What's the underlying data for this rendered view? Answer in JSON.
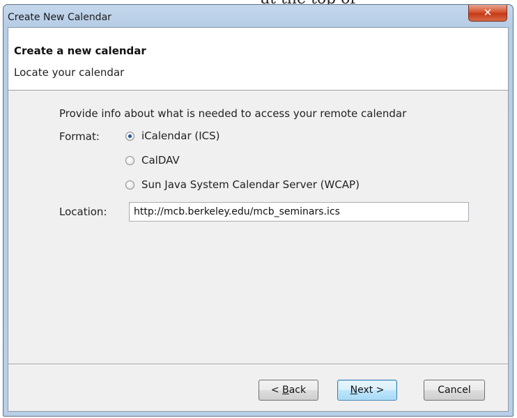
{
  "window": {
    "title": "Create New Calendar",
    "close_glyph": "✕"
  },
  "header": {
    "title": "Create a new calendar",
    "subtitle": "Locate your calendar"
  },
  "body": {
    "intro": "Provide info about what is needed to access your remote calendar",
    "format_label": "Format:",
    "formats": [
      {
        "label": "iCalendar (ICS)",
        "checked": true
      },
      {
        "label": "CalDAV",
        "checked": false
      },
      {
        "label": "Sun Java System Calendar Server (WCAP)",
        "checked": false
      }
    ],
    "location_label": "Location:",
    "location_value": "http://mcb.berkeley.edu/mcb_seminars.ics"
  },
  "buttons": {
    "back": {
      "before": "< ",
      "mnemonic": "B",
      "after": "ack"
    },
    "next": {
      "before": "",
      "mnemonic": "N",
      "after": "ext >"
    },
    "cancel": "Cancel"
  },
  "colors": {
    "frame": "#b9cfe7",
    "client": "#f0f0f0",
    "close_button": "#c63a17",
    "default_button_border": "#3c7fb1"
  },
  "icons": [
    "close-icon"
  ],
  "top_fragment": "at the top of the phone pane type"
}
